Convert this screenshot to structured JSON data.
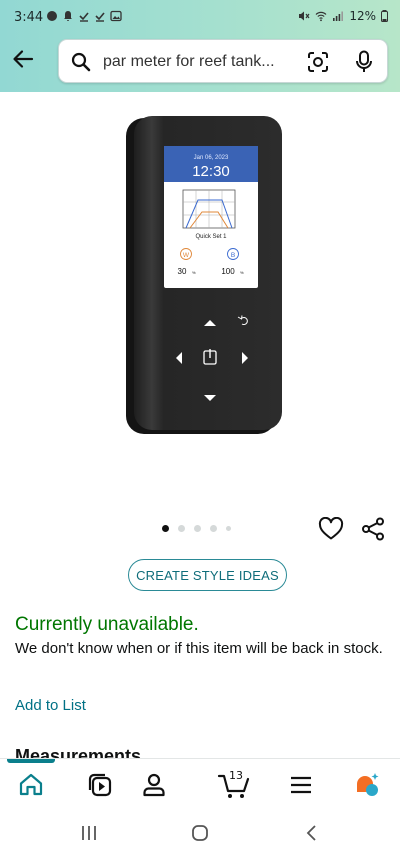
{
  "status_bar": {
    "time": "3:44",
    "battery": "12%"
  },
  "header": {
    "search_text": "par meter for reef tank..."
  },
  "product": {
    "device_date": "Jan 06, 2023",
    "device_time": "12:30",
    "device_mode": "Quick Set 1",
    "channel_w": "W",
    "channel_b": "B",
    "value_w": "30",
    "value_b": "100",
    "unit": "%"
  },
  "carousel": {
    "total": 5,
    "active": 1
  },
  "actions": {
    "create_style_ideas": "CREATE STYLE IDEAS"
  },
  "availability": {
    "status": "Currently unavailable.",
    "message": "We don't know when or if this item will be back in stock.",
    "add_to_list": "Add to List"
  },
  "section": {
    "title": "Measurements"
  },
  "bottom_nav": {
    "cart_count": "13",
    "items": [
      "home-icon",
      "play-icon",
      "account-icon",
      "cart-icon",
      "menu-icon",
      "ai-assistant-icon"
    ]
  },
  "colors": {
    "header_gradient_start": "#92d8d3",
    "header_gradient_end": "#b7e6c9",
    "link": "#007185",
    "available_green": "#007600",
    "accent": "#0a7f8c",
    "assistant_orange": "#f36e23"
  }
}
